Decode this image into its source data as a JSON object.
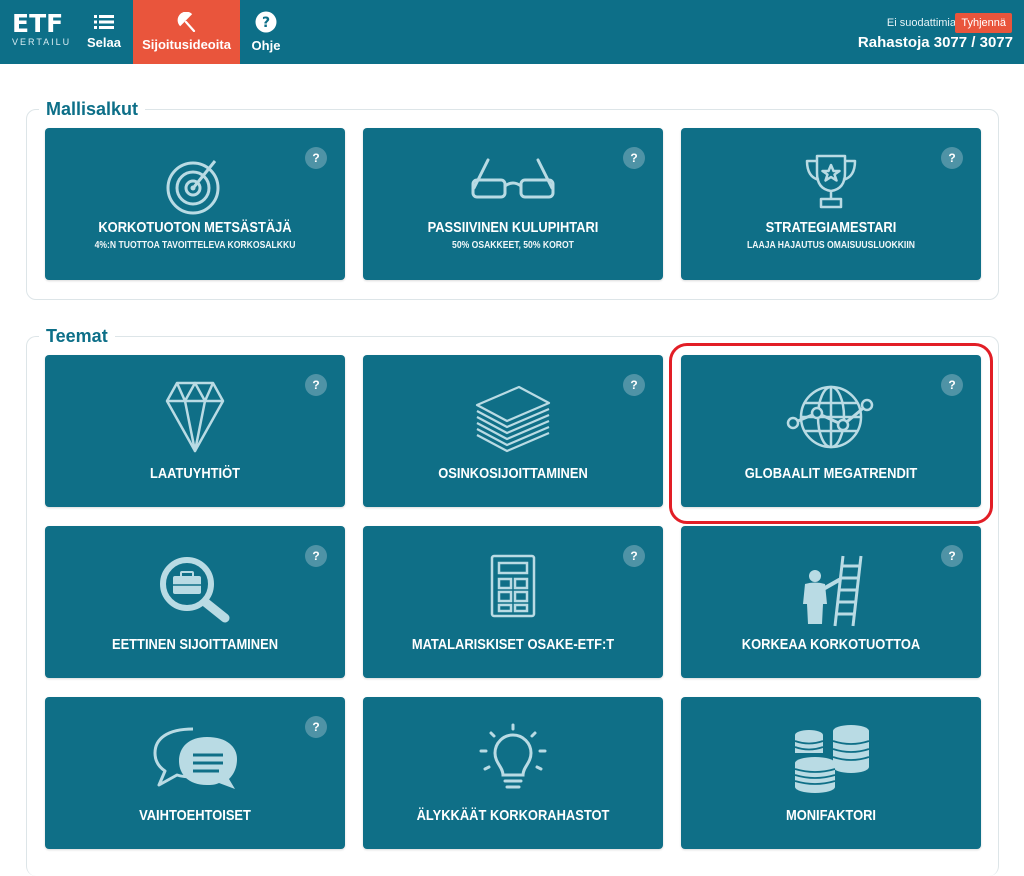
{
  "header": {
    "logo_main": "ETF",
    "logo_sub": "VERTAILU",
    "nav": [
      {
        "label": "Selaa",
        "icon": "list-icon"
      },
      {
        "label": "Sijoitusideoita",
        "icon": "umbrella-icon"
      },
      {
        "label": "Ohje",
        "icon": "question-circle-icon"
      }
    ],
    "filter_status": "Ei suodattimia",
    "clear_label": "Tyhjennä",
    "fund_count": "Rahastoja 3077 / 3077"
  },
  "colors": {
    "brand": "#0d6f88",
    "accent": "#e9553c",
    "highlight": "#e21e26"
  },
  "sections": [
    {
      "title": "Mallisalkut",
      "cards": [
        {
          "title": "KORKOTUOTON METSÄSTÄJÄ",
          "subtitle": "4%:N TUOTTOA TAVOITTELEVA KORKOSALKKU",
          "icon": "target-icon",
          "help": "?"
        },
        {
          "title": "PASSIIVINEN KULUPIHTARI",
          "subtitle": "50% OSAKKEET, 50% KOROT",
          "icon": "glasses-icon",
          "help": "?"
        },
        {
          "title": "STRATEGIAMESTARI",
          "subtitle": "LAAJA HAJAUTUS OMAISUUSLUOKKIIN",
          "icon": "trophy-icon",
          "help": "?"
        }
      ]
    },
    {
      "title": "Teemat",
      "cards": [
        {
          "title": "LAATUYHTIÖT",
          "icon": "diamond-icon",
          "help": "?"
        },
        {
          "title": "OSINKOSIJOITTAMINEN",
          "icon": "paper-stack-icon",
          "help": "?"
        },
        {
          "title": "GLOBAALIT MEGATRENDIT",
          "icon": "globe-icon",
          "help": "?"
        },
        {
          "title": "EETTINEN SIJOITTAMINEN",
          "icon": "magnifier-briefcase-icon",
          "help": "?"
        },
        {
          "title": "MATALARISKISET OSAKE-ETF:T",
          "icon": "calculator-icon",
          "help": "?"
        },
        {
          "title": "KORKEAA KORKOTUOTTOA",
          "icon": "ladder-icon",
          "help": "?"
        },
        {
          "title": "VAIHTOEHTOISET",
          "icon": "chat-bubbles-icon",
          "help": "?"
        },
        {
          "title": "ÄLYKKÄÄT KORKORAHASTOT",
          "icon": "lightbulb-icon"
        },
        {
          "title": "MONIFAKTORI",
          "icon": "database-icon"
        }
      ]
    }
  ]
}
